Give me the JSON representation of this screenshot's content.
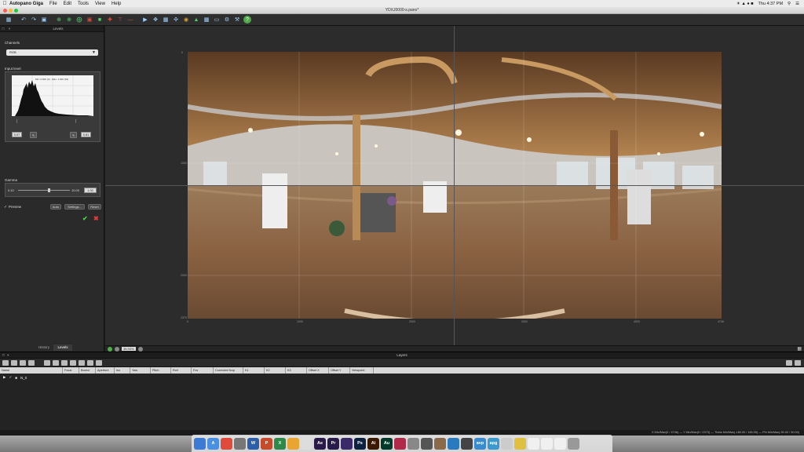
{
  "menubar": {
    "app": "Autopano Giga",
    "menus": [
      "File",
      "Edit",
      "Tools",
      "View",
      "Help"
    ],
    "clock": "Thu 4:37 PM"
  },
  "window": {
    "title": "YDXJ0000-s.pano*"
  },
  "toolbar": {
    "tooltip": "Levels"
  },
  "levels_panel": {
    "title": "Levels",
    "channels_label": "Channels",
    "channel_value": "RGB",
    "input_level_label": "Input level",
    "hist_info": "Min: 0.000 (0) - Max: 1.000 (63)",
    "input_min": "0.07",
    "input_max": "0.81",
    "gamma_label": "Gamma",
    "gamma_min": "0.10",
    "gamma_max": "10.00",
    "gamma_value": "1.00",
    "preview_label": "Preview",
    "auto_label": "Auto",
    "settings_label": "Settings...",
    "reset_label": "Reset",
    "tabs": [
      "History",
      "Levels"
    ]
  },
  "view": {
    "axis_x": [
      "0",
      "1000",
      "2000",
      "3000",
      "4000",
      "4746"
    ],
    "axis_y": [
      "0",
      "1000",
      "2000",
      "2373"
    ],
    "zoom": "35.93%"
  },
  "layers_panel": {
    "title": "Layers",
    "columns": [
      "Name",
      "Focal",
      "Boxed",
      "Aperture",
      "Iso",
      "Yaw",
      "Pitch",
      "Roll",
      "Fov",
      "Corrected fcop",
      "K1",
      "K2",
      "K3",
      "Offset X",
      "Offset Y",
      "Viewpoint"
    ],
    "rows": [
      {
        "name": "N_0"
      }
    ]
  },
  "status": {
    "text": "X Min/Max(0 / 4746)  —  Y Min/Max(0 / 2373)  —  Theta Min/Max(-180.00 / 180.00)  —  Phi Min/Max(-90.00 / 90.00)"
  },
  "dock": {
    "items": [
      {
        "label": "",
        "color": "#3b7bd6"
      },
      {
        "label": "A",
        "color": "#4a90e2"
      },
      {
        "label": "",
        "color": "#e04a3a"
      },
      {
        "label": "",
        "color": "#777777"
      },
      {
        "label": "W",
        "color": "#2b5faa"
      },
      {
        "label": "P",
        "color": "#c74a2a"
      },
      {
        "label": "X",
        "color": "#2f8a4a"
      },
      {
        "label": "",
        "color": "#e8a531"
      },
      {
        "label": "",
        "color": "#dddddd"
      },
      {
        "label": "Ae",
        "color": "#2a1a4a"
      },
      {
        "label": "Pr",
        "color": "#2a1a4a"
      },
      {
        "label": "",
        "color": "#3a2a6a"
      },
      {
        "label": "Ps",
        "color": "#0b2340"
      },
      {
        "label": "Ai",
        "color": "#3a1a00"
      },
      {
        "label": "Au",
        "color": "#003a2a"
      },
      {
        "label": "",
        "color": "#b02a4a"
      },
      {
        "label": "",
        "color": "#888888"
      },
      {
        "label": "",
        "color": "#555555"
      },
      {
        "label": "",
        "color": "#8a6a4a"
      },
      {
        "label": "",
        "color": "#2a7ac0"
      },
      {
        "label": "",
        "color": "#444444"
      },
      {
        "label": "avp",
        "color": "#3a8ad0"
      },
      {
        "label": "apg",
        "color": "#3a9ad0"
      },
      {
        "label": "",
        "color": "#cccccc"
      },
      {
        "label": "",
        "color": "#e0c040"
      },
      {
        "label": "",
        "color": "#f0f0f0"
      },
      {
        "label": "",
        "color": "#f0f0f0"
      },
      {
        "label": "",
        "color": "#f0f0f0"
      },
      {
        "label": "",
        "color": "#999999"
      }
    ]
  }
}
